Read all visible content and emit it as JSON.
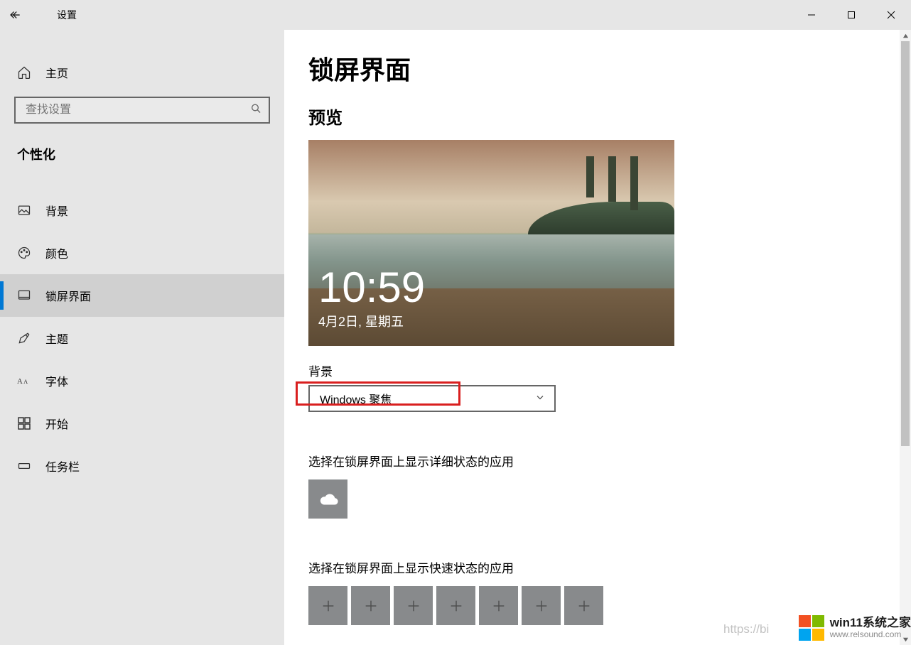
{
  "titlebar": {
    "app": "设置"
  },
  "sidebar": {
    "home": "主页",
    "search_placeholder": "查找设置",
    "section": "个性化",
    "items": [
      {
        "label": "背景"
      },
      {
        "label": "颜色"
      },
      {
        "label": "锁屏界面"
      },
      {
        "label": "主题"
      },
      {
        "label": "字体"
      },
      {
        "label": "开始"
      },
      {
        "label": "任务栏"
      }
    ],
    "active_index": 2
  },
  "content": {
    "page_title": "锁屏界面",
    "preview_heading": "预览",
    "preview": {
      "time": "10:59",
      "date": "4月2日, 星期五"
    },
    "background_label": "背景",
    "background_select": {
      "value": "Windows 聚焦"
    },
    "detail_app_label": "选择在锁屏界面上显示详细状态的应用",
    "detail_app_icon": "weather-icon",
    "quick_app_label": "选择在锁屏界面上显示快速状态的应用",
    "quick_slots": 7
  },
  "status": {
    "url_fragment": "https://bi"
  },
  "watermark": {
    "title": "win11系统之家",
    "sub": "www.relsound.com",
    "colors": [
      "#f25022",
      "#7fba00",
      "#00a4ef",
      "#ffb900"
    ]
  }
}
